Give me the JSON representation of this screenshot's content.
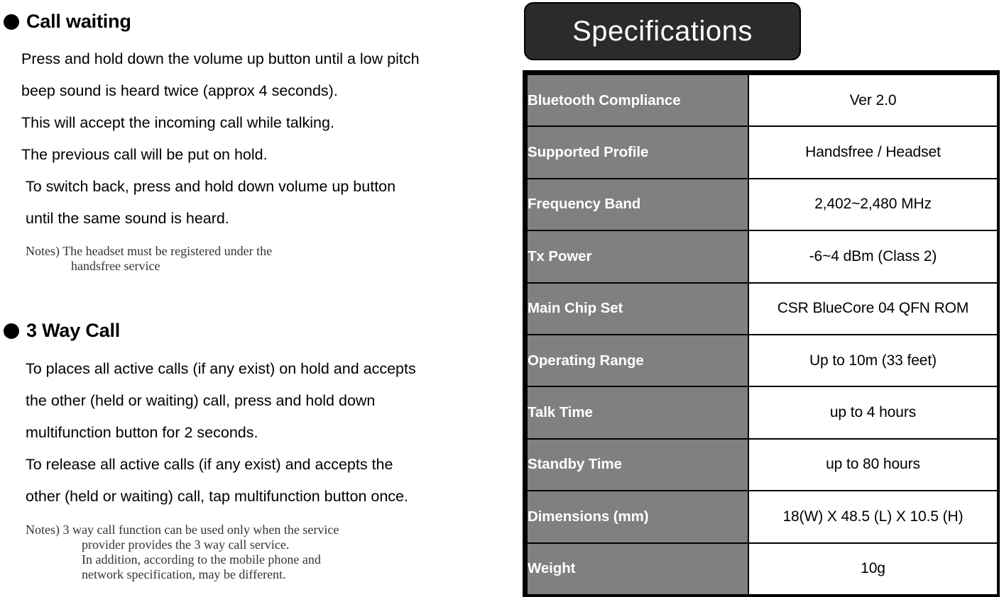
{
  "left": {
    "sections": [
      {
        "id": "call-waiting",
        "heading": "Call waiting",
        "lines": [
          "Press and hold down the volume up button until a low pitch",
          "beep sound is heard twice (approx 4 seconds).",
          "This will accept the incoming call while talking.",
          "The previous call will be put on hold.",
          "To switch back, press and hold down volume up button",
          "until the same sound is heard."
        ],
        "notes": [
          "Notes) The headset must be registered under the",
          "handsfree service"
        ]
      },
      {
        "id": "three-way-call",
        "heading": "3 Way Call",
        "lines": [
          "To places all active calls (if any exist) on hold and accepts",
          "the other (held or waiting) call, press and hold down",
          "multifunction button for 2 seconds.",
          "To release all active calls (if any exist) and accepts the",
          "other (held or waiting) call, tap multifunction button once."
        ],
        "notes": [
          "Notes) 3 way call function can be used only when the service",
          "provider provides the 3 way call service.",
          "In addition, according to the mobile phone and",
          "network specification, may be different."
        ]
      }
    ]
  },
  "right": {
    "title": "Specifications",
    "table": {
      "rows": [
        {
          "label": "Bluetooth Compliance",
          "value": "Ver 2.0"
        },
        {
          "label": "Supported Profile",
          "value": "Handsfree / Headset"
        },
        {
          "label": "Frequency Band",
          "value": "2,402~2,480 MHz"
        },
        {
          "label": "Tx Power",
          "value": "-6~4 dBm (Class 2)"
        },
        {
          "label": "Main Chip Set",
          "value": "CSR BlueCore 04 QFN ROM"
        },
        {
          "label": "Operating Range",
          "value": "Up to 10m (33 feet)"
        },
        {
          "label": "Talk Time",
          "value": "up to 4 hours"
        },
        {
          "label": "Standby Time",
          "value": "up to 80 hours"
        },
        {
          "label": "Dimensions (mm)",
          "value": "18(W) X 48.5 (L) X 10.5 (H)"
        },
        {
          "label": "Weight",
          "value": "10g"
        }
      ]
    }
  },
  "colors": {
    "title_box_bg": "#2b2b2b",
    "label_cell_bg": "#808080",
    "border": "#000000",
    "note_text": "#333333"
  }
}
